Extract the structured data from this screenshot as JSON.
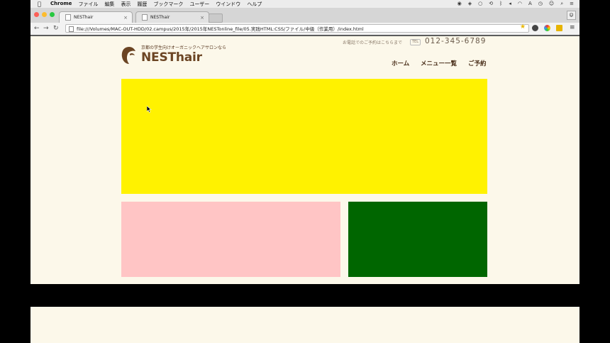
{
  "menubar": {
    "app_name": "Chrome",
    "menus": [
      "ファイル",
      "編集",
      "表示",
      "履歴",
      "ブックマーク",
      "ユーザー",
      "ウインドウ",
      "ヘルプ"
    ]
  },
  "tabs": [
    {
      "title": "NESThair",
      "active": true
    },
    {
      "title": "NESThair",
      "active": false
    }
  ],
  "toolbar": {
    "url": "file:///Volumes/MAC-OUT-HDD/02.campus/2015年/2015年NESTonline_file/05.実践HTML:CSS/ファイル/中級（作業用）/index.html"
  },
  "site": {
    "tagline": "京都の学生向けオーガニックヘアサロンなら",
    "logo_text": "NESThair",
    "tel_label": "お電話でのご予約はこちらまで",
    "tel_badge": "TEL",
    "tel_number": "012-345-6789",
    "nav": [
      "ホーム",
      "メニュー一覧",
      "ご予約"
    ]
  },
  "colors": {
    "hero": "#fff200",
    "box_pink": "#ffc5c5",
    "box_green": "#006600",
    "page_bg": "#fcf8ea",
    "brand_brown": "#6b4423"
  }
}
